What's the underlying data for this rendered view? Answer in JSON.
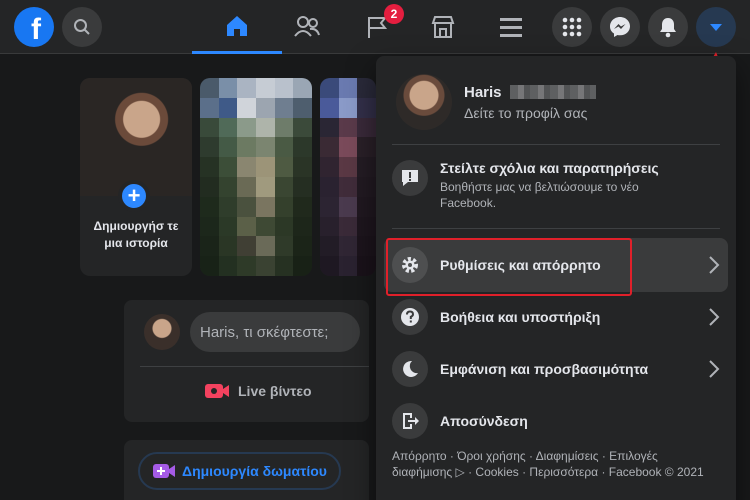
{
  "topbar": {
    "logo_letter": "f",
    "notification_count": "2",
    "icons": [
      "search-icon",
      "home-icon",
      "friends-icon",
      "flag-icon",
      "marketplace-icon",
      "menu-lines-icon",
      "apps-grid-icon",
      "messenger-icon",
      "bell-icon",
      "caret-down-icon"
    ],
    "accent": "#2d88ff"
  },
  "stories": {
    "create_label": "Δημιουργήσ τε μια ιστορία"
  },
  "composer": {
    "placeholder": "Haris, τι σκέφτεστε;",
    "live_label": "Live βίντεο"
  },
  "rooms": {
    "create_room_label": "Δημιουργία δωματίου"
  },
  "menu": {
    "profile_name": "Haris",
    "profile_sub": "Δείτε το προφίλ σας",
    "feedback_title": "Στείλτε σχόλια και παρατηρήσεις",
    "feedback_sub": "Βοηθήστε μας να βελτιώσουμε το νέο Facebook.",
    "settings_label": "Ρυθμίσεις και απόρρητο",
    "help_label": "Βοήθεια και υποστήριξη",
    "display_label": "Εμφάνιση και προσβασιμότητα",
    "logout_label": "Αποσύνδεση",
    "footer": "Απόρρητο · Όροι χρήσης · Διαφημίσεις · Επιλογές διαφήμισης ▷ · Cookies · Περισσότερα · Facebook © 2021"
  },
  "colors": {
    "background": "#18191a",
    "surface": "#242526",
    "highlight_box": "#e0202a",
    "badge": "#e41e3f"
  }
}
